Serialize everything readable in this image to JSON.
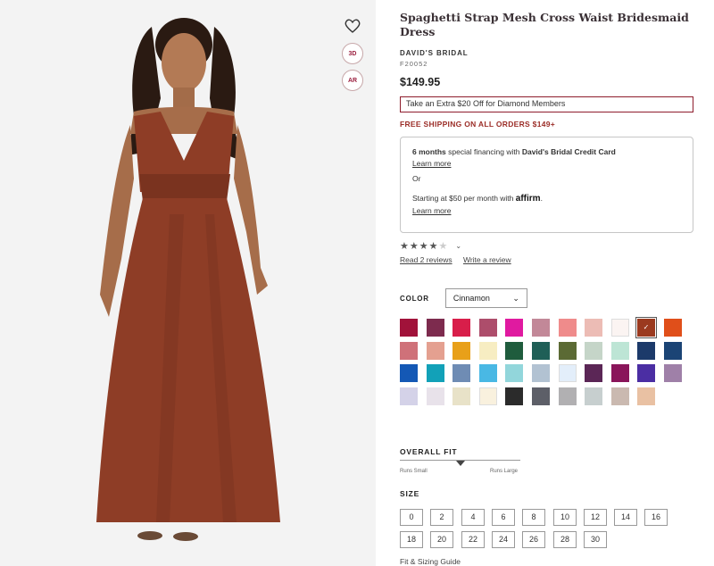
{
  "product": {
    "title": "Spaghetti Strap Mesh Cross Waist Bridesmaid Dress",
    "brand": "DAVID'S BRIDAL",
    "sku": "F20052",
    "price": "$149.95",
    "promo": "Take an Extra $20 Off for Diamond Members",
    "shipping": "FREE SHIPPING ON ALL ORDERS $149+"
  },
  "image_actions": {
    "btn_3d": "3D",
    "btn_ar": "AR"
  },
  "financing": {
    "line1_bold": "6 months",
    "line1_mid": " special financing with ",
    "line1_card": "David's Bridal Credit Card",
    "learn_more_1": "Learn more",
    "or": "Or",
    "monthly": "Starting at $50 per month with",
    "affirm": "affirm",
    "learn_more_2": "Learn more"
  },
  "rating": {
    "stars_filled": "★★★★",
    "stars_empty": "★",
    "read_reviews": "Read 2 reviews",
    "write_review": "Write a review"
  },
  "color": {
    "label": "COLOR",
    "selected": "Cinnamon",
    "swatches": [
      "#a1123a",
      "#7d2b4e",
      "#d81e4a",
      "#ad4d6b",
      "#e01aa0",
      "#c28898",
      "#ef8b8b",
      "#ecbcb5",
      "#fbf4f2",
      "#9b3a1f",
      "#e04f1a",
      "#cf7179",
      "#e4a090",
      "#e8a019",
      "#f7edc2",
      "#1f5c3d",
      "#1f5f57",
      "#5b6a34",
      "#c5d5c8",
      "#bde5d5",
      "#1c3a6a",
      "#1b4475",
      "#1458b5",
      "#12a1b8",
      "#6f8cb4",
      "#49b8e4",
      "#92d6db",
      "#b2c2d2",
      "#e3eefa",
      "#5b2656",
      "#8a155a",
      "#4b2ea3",
      "#9f80a8",
      "#d4d2e8",
      "#e8e2ea",
      "#e8e2c8",
      "#f9f1de",
      "#2b2b2b",
      "#5d5f68",
      "#b1b0b2",
      "#c7cfcf",
      "#cab9b0",
      "#e9c1a3"
    ],
    "selected_index": 9
  },
  "fit": {
    "label": "OVERALL FIT",
    "small": "Runs Small",
    "large": "Runs Large",
    "level": 0.5
  },
  "size": {
    "label": "SIZE",
    "options": [
      "0",
      "2",
      "4",
      "6",
      "8",
      "10",
      "12",
      "14",
      "16",
      "18",
      "20",
      "22",
      "24",
      "26",
      "28",
      "30"
    ],
    "guide": "Fit & Sizing Guide"
  }
}
